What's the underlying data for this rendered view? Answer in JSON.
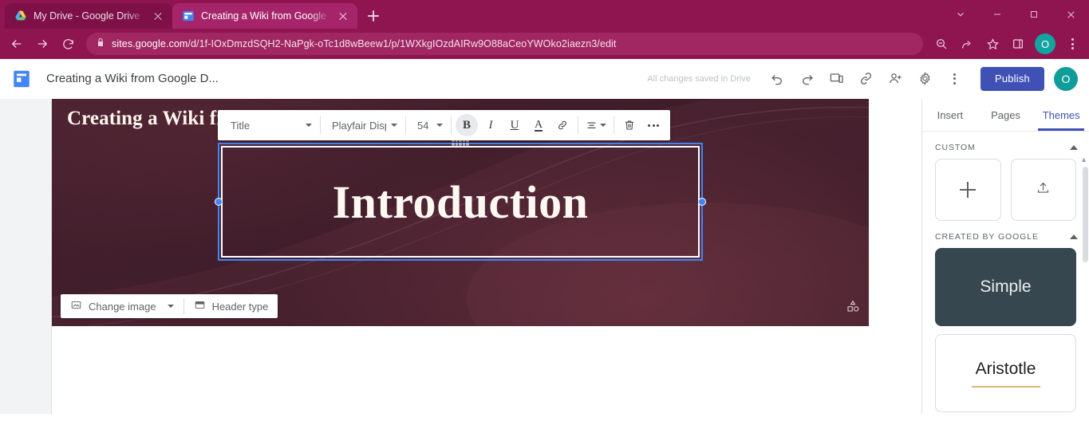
{
  "browser": {
    "tabs": [
      {
        "title": "My Drive - Google Drive",
        "favicon": "google-drive-icon",
        "active": false
      },
      {
        "title": "Creating a Wiki from Google Doc",
        "favicon": "google-sites-icon",
        "active": true
      }
    ],
    "new_tab_label": "+",
    "window_controls": [
      "tab-search-chevron",
      "minimize",
      "maximize",
      "close"
    ],
    "nav": {
      "back": "back-arrow",
      "forward": "forward-arrow",
      "reload": "reload-icon"
    },
    "omnibox": {
      "lock": "lock-icon",
      "domain": "sites.google.com",
      "path": "/d/1f-IOxDmzdSQH2-NaPgk-oTc1d8wBeew1/p/1WXkgIOzdAIRw9O88aCeoYWOko2iaezn3/edit"
    },
    "toolbar_icons": [
      "zoom-out-icon",
      "share-icon",
      "bookmark-star-icon",
      "side-panel-icon"
    ],
    "profile_initial": "O",
    "menu": "three-dot-menu-icon",
    "colors": {
      "chrome_bg": "#8e1550",
      "active_tab": "#a6256a",
      "omnibox": "#a02762",
      "profile": "#12a4a0"
    }
  },
  "app_header": {
    "logo": "google-sites-logo",
    "site_title": "Creating a Wiki from Google D...",
    "save_status": "All changes saved in Drive",
    "icons": [
      "undo-icon",
      "redo-icon",
      "preview-icon",
      "copy-link-icon",
      "share-with-others-icon",
      "settings-gear-icon",
      "more-options-icon"
    ],
    "publish_label": "Publish",
    "account_initial": "O",
    "publish_color": "#3f51b5"
  },
  "text_toolbar": {
    "style": "Title",
    "font": "Playfair Disp",
    "size": "54",
    "bold": "B",
    "italic": "I",
    "underline": "U",
    "text_color": "A",
    "link": "link-icon",
    "align": "align-icon",
    "delete": "trash-icon",
    "more": "more-icon",
    "bold_active": true
  },
  "banner": {
    "site_name": "Creating a Wiki from Google",
    "headline": "Introduction",
    "delete_button": "delete-banner-icon",
    "shapes_indicator": "shapes-icon",
    "tools": {
      "change_image": "Change image",
      "change_image_icon": "image-icon",
      "header_type": "Header type",
      "header_type_icon": "header-layout-icon"
    },
    "background_color": "#3f1d2a"
  },
  "right_panel": {
    "tabs": [
      {
        "label": "Insert",
        "active": false
      },
      {
        "label": "Pages",
        "active": false
      },
      {
        "label": "Themes",
        "active": true
      }
    ],
    "sections": [
      {
        "title": "CUSTOM",
        "collapse_icon": "chevron-up-icon",
        "cards": [
          {
            "type": "blank",
            "icon": "plus-icon"
          },
          {
            "type": "blank",
            "icon": "upload-icon"
          }
        ]
      },
      {
        "title": "CREATED BY GOOGLE",
        "collapse_icon": "chevron-up-icon",
        "themes": [
          {
            "name": "Simple",
            "style": "dark",
            "bg": "#37474f",
            "rule": false
          },
          {
            "name": "Aristotle",
            "style": "light",
            "bg": "#ffffff",
            "rule": true,
            "rule_color": "#d6b871"
          }
        ]
      }
    ]
  }
}
